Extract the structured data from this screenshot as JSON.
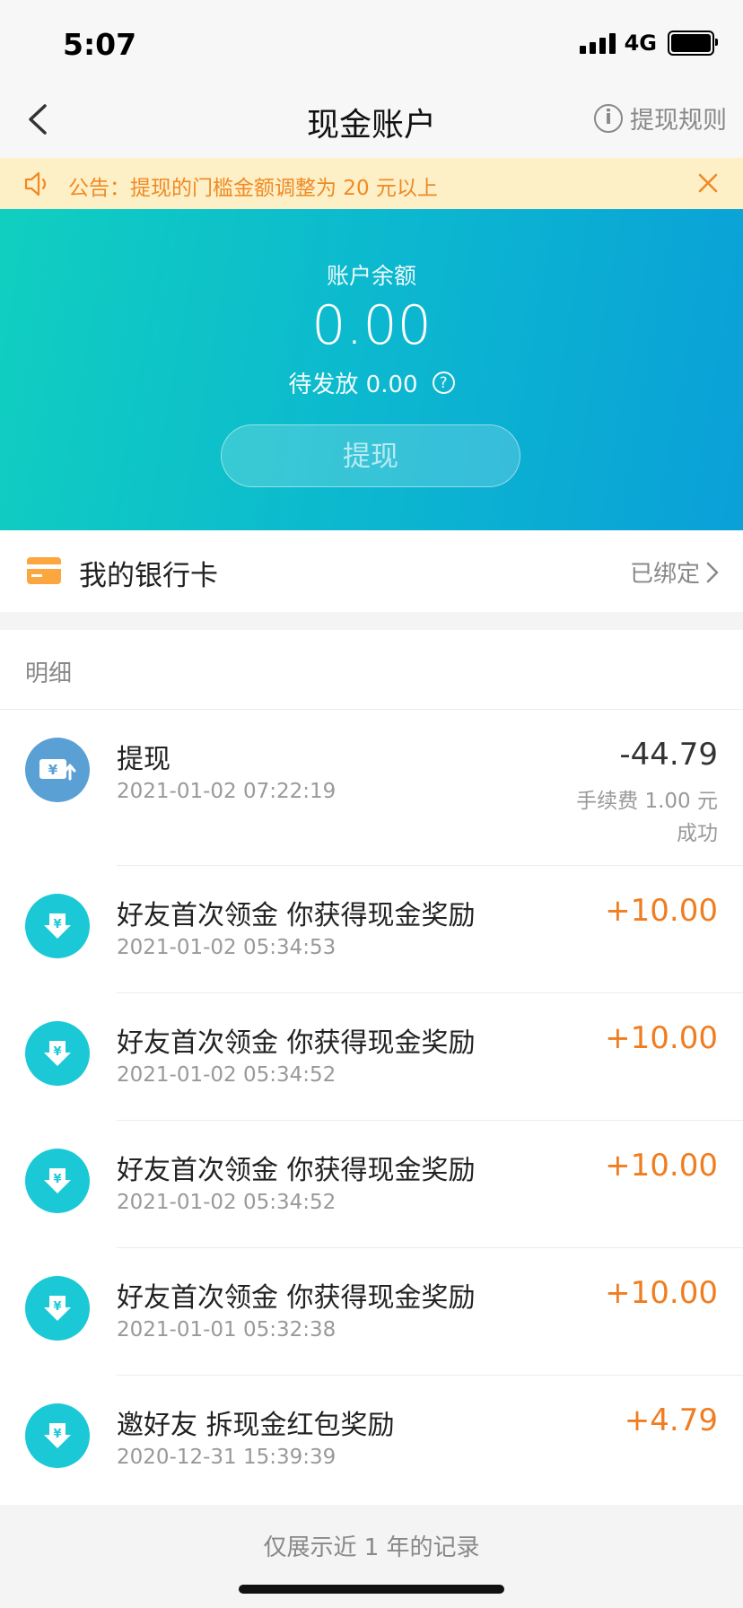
{
  "status_bar": {
    "time": "5:07",
    "network": "4G"
  },
  "nav": {
    "title": "现金账户",
    "rules_label": "提现规则"
  },
  "notice": {
    "text": "公告：提现的门槛金额调整为 20 元以上"
  },
  "balance": {
    "label": "账户余额",
    "amount": "0.00",
    "pending": "待发放 0.00",
    "withdraw_label": "提现"
  },
  "bank_card": {
    "label": "我的银行卡",
    "status": "已绑定"
  },
  "details": {
    "header": "明细",
    "records": [
      {
        "title": "提现",
        "date": "2021-01-02 07:22:19",
        "amount": "-44.79",
        "fee": "手续费 1.00 元",
        "status": "成功"
      },
      {
        "title": "好友首次领金 你获得现金奖励",
        "date": "2021-01-02 05:34:53",
        "amount": "+10.00"
      },
      {
        "title": "好友首次领金 你获得现金奖励",
        "date": "2021-01-02 05:34:52",
        "amount": "+10.00"
      },
      {
        "title": "好友首次领金 你获得现金奖励",
        "date": "2021-01-02 05:34:52",
        "amount": "+10.00"
      },
      {
        "title": "好友首次领金 你获得现金奖励",
        "date": "2021-01-01 05:32:38",
        "amount": "+10.00"
      },
      {
        "title": "邀好友 拆现金红包奖励",
        "date": "2020-12-31 15:39:39",
        "amount": "+4.79"
      }
    ],
    "footer": "仅展示近 1 年的记录"
  },
  "colors": {
    "accent_orange": "#f07d20",
    "hero_teal": "#10cfc0",
    "hero_blue": "#0aa0d8",
    "notice_bg": "#fdefc6",
    "income_icon": "#1bc9d6",
    "withdraw_icon": "#5aa0d5"
  },
  "icons": {
    "back": "chevron-left-icon",
    "rules": "info-icon",
    "notice": "speaker-icon",
    "notice_close": "close-icon",
    "pending_help": "question-icon",
    "bank": "bank-card-icon",
    "bank_arrow": "chevron-right-icon",
    "withdraw_record": "yuan-upload-icon",
    "income_record": "yuan-download-icon"
  }
}
